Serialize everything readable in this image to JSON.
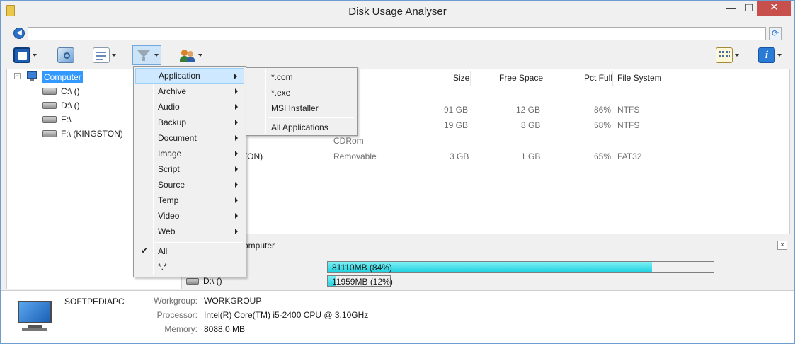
{
  "window": {
    "title": "Disk Usage Analyser",
    "minimize": "—",
    "maximize": "☐",
    "close": "✕"
  },
  "address": {
    "value": "",
    "back_glyph": "◀",
    "refresh_glyph": "⟳"
  },
  "toolbar": {
    "icons": [
      "drive-browse-icon",
      "scan-icon",
      "report-icon",
      "filter-icon",
      "users-icon",
      "view-icon",
      "info-icon"
    ]
  },
  "tree": {
    "root": {
      "label": "Computer",
      "expander": "−"
    },
    "drives": [
      "C:\\ ()",
      "D:\\ ()",
      "E:\\",
      "F:\\ (KINGSTON)"
    ]
  },
  "list": {
    "columns": [
      "Size",
      "Free Space",
      "Pct Full",
      "File System"
    ],
    "rows": [
      {
        "name": "",
        "type": "",
        "size": "91 GB",
        "free": "12 GB",
        "pct": "86%",
        "fs": "NTFS"
      },
      {
        "name": "",
        "type": "",
        "size": "19 GB",
        "free": "8 GB",
        "pct": "58%",
        "fs": "NTFS"
      },
      {
        "name": "",
        "type": "CDRom",
        "size": "",
        "free": "",
        "pct": "",
        "fs": ""
      },
      {
        "name": "TON)",
        "type": "Removable",
        "size": "3 GB",
        "free": "1 GB",
        "pct": "65%",
        "fs": "FAT32"
      }
    ]
  },
  "panel": {
    "title": "omputer",
    "close": "×",
    "bars": [
      {
        "drive": "",
        "label": "81110MB (84%)",
        "fill": 0.84,
        "color": "#22d3e0"
      },
      {
        "drive": "D:\\ ()",
        "label": "11959MB (12%)",
        "fill": 0.12,
        "color": "#22d3e0"
      }
    ]
  },
  "info": {
    "computer_name": "SOFTPEDIAPC",
    "workgroup_label": "Workgroup:",
    "workgroup": "WORKGROUP",
    "processor_label": "Processor:",
    "processor": "Intel(R) Core(TM) i5-2400 CPU @ 3.10GHz",
    "memory_label": "Memory:",
    "memory": "8088.0 MB"
  },
  "filter_menu": {
    "items": [
      "Application",
      "Archive",
      "Audio",
      "Backup",
      "Document",
      "Image",
      "Script",
      "Source",
      "Temp",
      "Video",
      "Web"
    ],
    "highlighted": "Application",
    "all_label": "All",
    "all_checked_glyph": "✔",
    "wildcard_label": "*.*"
  },
  "application_submenu": {
    "items": [
      "*.com",
      "*.exe",
      "MSI Installer"
    ],
    "all_label": "All Applications"
  }
}
